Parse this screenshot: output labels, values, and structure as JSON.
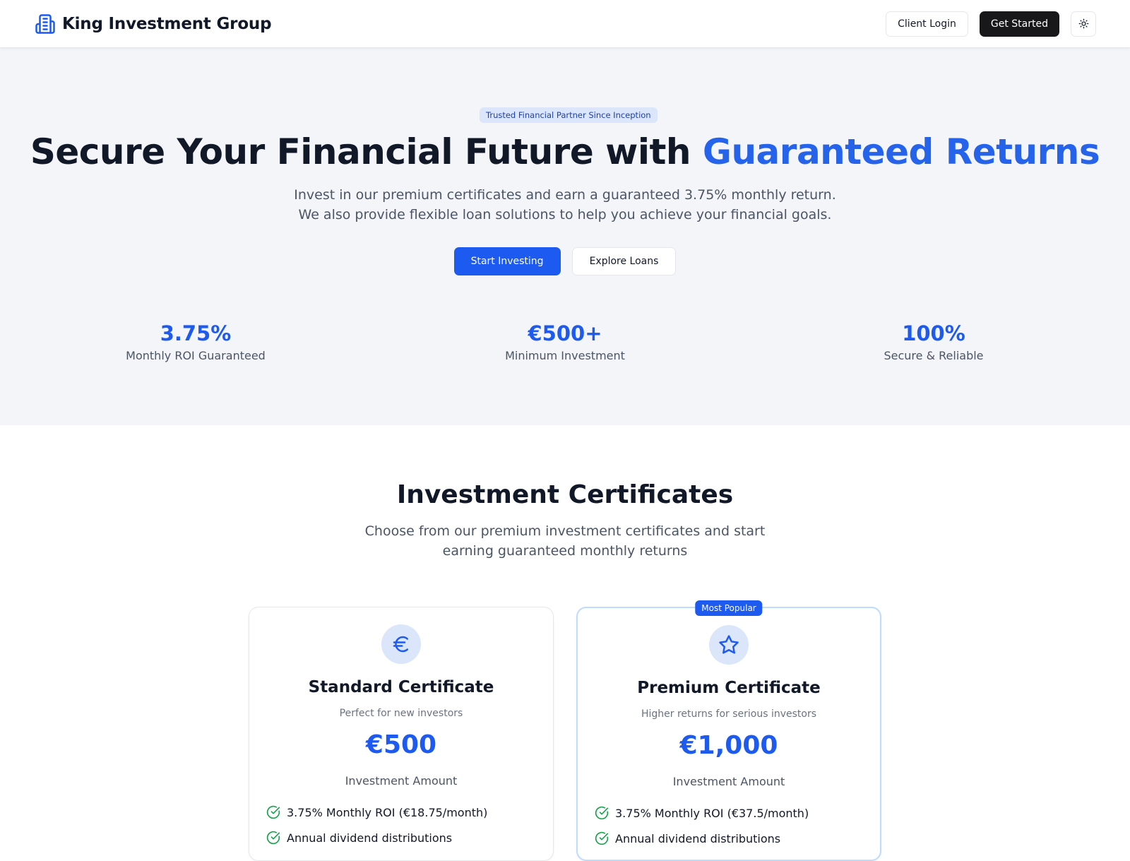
{
  "header": {
    "brand_name": "King Investment Group",
    "login_label": "Client Login",
    "get_started_label": "Get Started"
  },
  "hero": {
    "badge": "Trusted Financial Partner Since Inception",
    "title_main": "Secure Your Financial Future with ",
    "title_accent": "Guaranteed Returns",
    "subtitle": "Invest in our premium certificates and earn a guaranteed 3.75% monthly return. We also provide flexible loan solutions to help you achieve your financial goals.",
    "cta_primary": "Start Investing",
    "cta_secondary": "Explore Loans",
    "stats": [
      {
        "value": "3.75%",
        "label": "Monthly ROI Guaranteed"
      },
      {
        "value": "€500+",
        "label": "Minimum Investment"
      },
      {
        "value": "100%",
        "label": "Secure & Reliable"
      }
    ]
  },
  "certificates": {
    "title": "Investment Certificates",
    "subtitle": "Choose from our premium investment certificates and start earning guaranteed monthly returns",
    "popular_badge": "Most Popular",
    "cards": [
      {
        "icon": "euro-icon",
        "name": "Standard Certificate",
        "description": "Perfect for new investors",
        "amount": "€500",
        "amount_label": "Investment Amount",
        "features": [
          "3.75% Monthly ROI (€18.75/month)",
          "Annual dividend distributions"
        ]
      },
      {
        "icon": "star-icon",
        "name": "Premium Certificate",
        "description": "Higher returns for serious investors",
        "amount": "€1,000",
        "amount_label": "Investment Amount",
        "features": [
          "3.75% Monthly ROI (€37.5/month)",
          "Annual dividend distributions"
        ]
      }
    ]
  },
  "colors": {
    "accent": "#1d5af0",
    "accent_light": "#dbe6fb",
    "dark_button": "#18181b",
    "hero_bg": "#f3f5f9",
    "check": "#16a34a"
  }
}
